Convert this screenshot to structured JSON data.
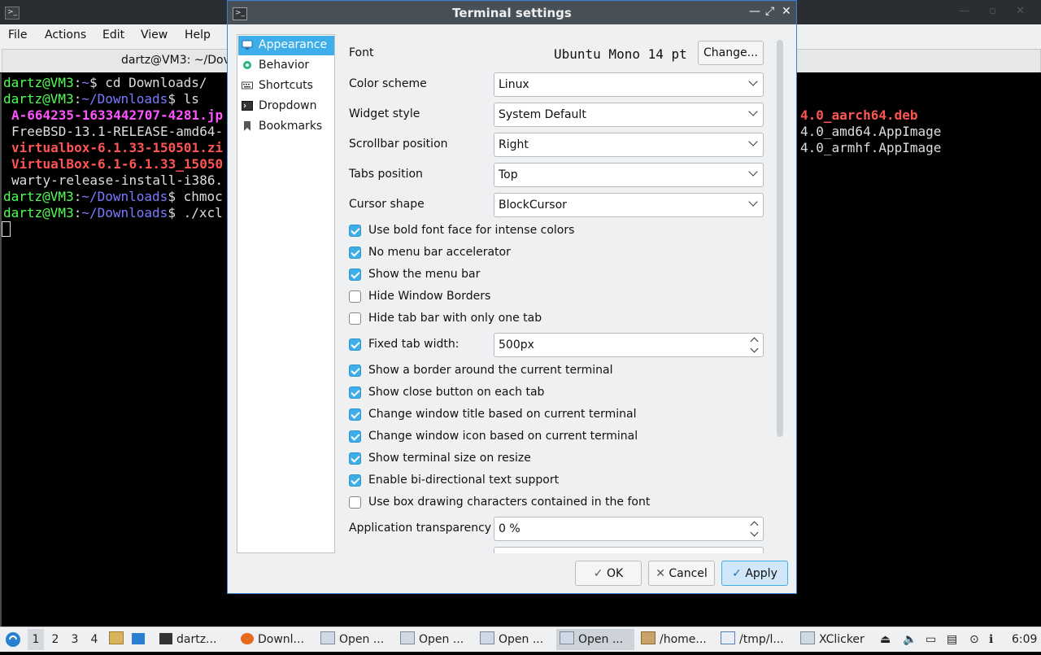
{
  "terminal": {
    "icon": "terminal-icon",
    "tab_title": "dartz@VM3: ~/Dov",
    "menu": [
      "File",
      "Actions",
      "Edit",
      "View",
      "Help"
    ],
    "lines": [
      {
        "prompt": "dartz@VM3",
        "path": "~",
        "cmd": "$ cd Downloads/"
      },
      {
        "prompt": "dartz@VM3",
        "path": "~/Downloads",
        "cmd": "$ ls"
      }
    ],
    "files_left": [
      {
        "name": "A-664235-1633442707-4281.jp",
        "color": "#ff54ff"
      },
      {
        "name": "FreeBSD-13.1-RELEASE-amd64-",
        "color": "#dddddd"
      },
      {
        "name": "virtualbox-6.1.33-150501.zi",
        "color": "#ff5454"
      },
      {
        "name": "VirtualBox-6.1-6.1.33_15050",
        "color": "#ff5454"
      },
      {
        "name": "warty-release-install-i386.",
        "color": "#dddddd"
      }
    ],
    "files_right": [
      {
        "name": "4.0_aarch64.deb",
        "color": "#ff5454"
      },
      {
        "name": "4.0_amd64.AppImage",
        "color": "#dddddd"
      },
      {
        "name": "4.0_armhf.AppImage",
        "color": "#dddddd"
      }
    ],
    "line6": {
      "prompt": "dartz@VM3",
      "path": "~/Downloads",
      "cmd": "$ chmoc"
    },
    "line7": {
      "prompt": "dartz@VM3",
      "path": "~/Downloads",
      "cmd": "$ ./xcl"
    }
  },
  "dialog": {
    "title": "Terminal settings",
    "sidebar": [
      {
        "label": "Appearance",
        "icon": "monitor-icon",
        "selected": true
      },
      {
        "label": "Behavior",
        "icon": "gear-icon",
        "selected": false
      },
      {
        "label": "Shortcuts",
        "icon": "keyboard-icon",
        "selected": false
      },
      {
        "label": "Dropdown",
        "icon": "dropdown-terminal-icon",
        "selected": false
      },
      {
        "label": "Bookmarks",
        "icon": "bookmark-icon",
        "selected": false
      }
    ],
    "font": {
      "label": "Font",
      "value": "Ubuntu Mono 14 pt",
      "button": "Change..."
    },
    "combos": [
      {
        "label": "Color scheme",
        "value": "Linux"
      },
      {
        "label": "Widget style",
        "value": "System Default"
      },
      {
        "label": "Scrollbar position",
        "value": "Right"
      },
      {
        "label": "Tabs position",
        "value": "Top"
      },
      {
        "label": "Cursor shape",
        "value": "BlockCursor"
      }
    ],
    "checks_a": [
      {
        "label": "Use bold font face for intense colors",
        "checked": true
      },
      {
        "label": "No menu bar accelerator",
        "checked": true
      },
      {
        "label": "Show the menu bar",
        "checked": true
      },
      {
        "label": "Hide Window Borders",
        "checked": false
      },
      {
        "label": "Hide tab bar with only one tab",
        "checked": false
      }
    ],
    "fixed_tab": {
      "label": "Fixed tab width:",
      "checked": true,
      "value": "500px"
    },
    "checks_b": [
      {
        "label": "Show a border around the current terminal",
        "checked": true
      },
      {
        "label": "Show close button on each tab",
        "checked": true
      },
      {
        "label": "Change window title based on current terminal",
        "checked": true
      },
      {
        "label": "Change window icon based on current terminal",
        "checked": true
      },
      {
        "label": "Show terminal size on resize",
        "checked": true
      },
      {
        "label": "Enable bi-directional text support",
        "checked": true
      },
      {
        "label": "Use box drawing characters contained in the font",
        "checked": false
      }
    ],
    "transparency": {
      "label": "Application transparency",
      "value": "0 %"
    },
    "buttons": {
      "ok": "OK",
      "cancel": "Cancel",
      "apply": "Apply"
    }
  },
  "taskbar": {
    "desktops": [
      "1",
      "2",
      "3",
      "4"
    ],
    "current_desktop": "1",
    "tasks": [
      {
        "label": "dartz...",
        "icon": "terminal-icon"
      },
      {
        "label": "Downl...",
        "icon": "firefox-icon"
      },
      {
        "label": "Open ...",
        "icon": "window-icon"
      },
      {
        "label": "Open ...",
        "icon": "window-icon"
      },
      {
        "label": "Open ...",
        "icon": "window-icon"
      },
      {
        "label": "Open ...",
        "icon": "window-icon",
        "active": true
      },
      {
        "label": "/home...",
        "icon": "archive-icon"
      },
      {
        "label": "/tmp/l...",
        "icon": "text-editor-icon"
      },
      {
        "label": "XClicker",
        "icon": "window-icon"
      }
    ],
    "clock": "6:09"
  }
}
